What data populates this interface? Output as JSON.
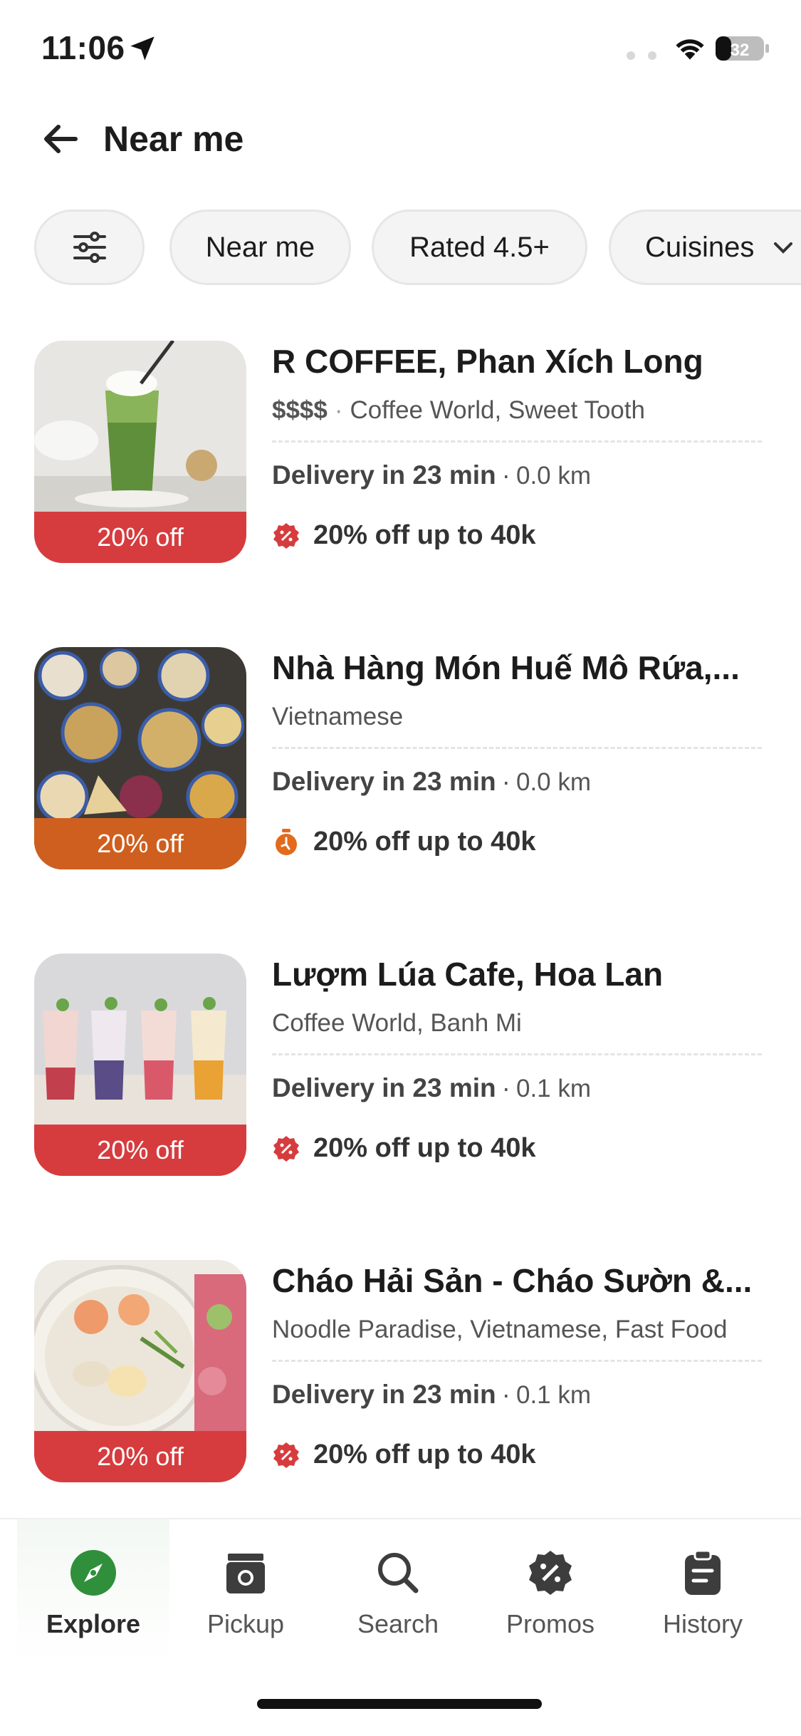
{
  "status_bar": {
    "time": "11:06",
    "battery": "32"
  },
  "header": {
    "title": "Near me"
  },
  "filters": {
    "chips": [
      {
        "label": "Near me"
      },
      {
        "label": "Rated 4.5+"
      },
      {
        "label": "Cuisines"
      }
    ]
  },
  "restaurants": [
    {
      "name": "R COFFEE, Phan Xích Long",
      "price": "$$$$",
      "categories": "Coffee World, Sweet Tooth",
      "delivery": "Delivery in 23 min",
      "distance": "0.0 km",
      "discount_badge": "20% off",
      "promo": "20% off up to 40k"
    },
    {
      "name": "Nhà Hàng Món Huế Mô Rứa,...",
      "price": "",
      "categories": "Vietnamese",
      "delivery": "Delivery in 23 min",
      "distance": "0.0 km",
      "discount_badge": "20% off",
      "promo": "20% off up to 40k"
    },
    {
      "name": "Lượm Lúa Cafe, Hoa Lan",
      "price": "",
      "categories": "Coffee World, Banh Mi",
      "delivery": "Delivery in 23 min",
      "distance": "0.1 km",
      "discount_badge": "20% off",
      "promo": "20% off up to 40k"
    },
    {
      "name": "Cháo Hải Sản - Cháo Sườn &...",
      "price": "",
      "categories": "Noodle Paradise, Vietnamese, Fast Food",
      "delivery": "Delivery in 23 min",
      "distance": "0.1 km",
      "discount_badge": "20% off",
      "promo": "20% off up to 40k"
    }
  ],
  "bottom_nav": {
    "items": [
      {
        "label": "Explore",
        "icon": "compass-icon"
      },
      {
        "label": "Pickup",
        "icon": "store-icon"
      },
      {
        "label": "Search",
        "icon": "search-icon"
      },
      {
        "label": "Promos",
        "icon": "discount-icon"
      },
      {
        "label": "History",
        "icon": "clipboard-icon"
      }
    ]
  },
  "colors": {
    "accent_green": "#2f8f3a",
    "badge_red": "#d63c3e",
    "badge_orange": "#cf5f1e"
  }
}
